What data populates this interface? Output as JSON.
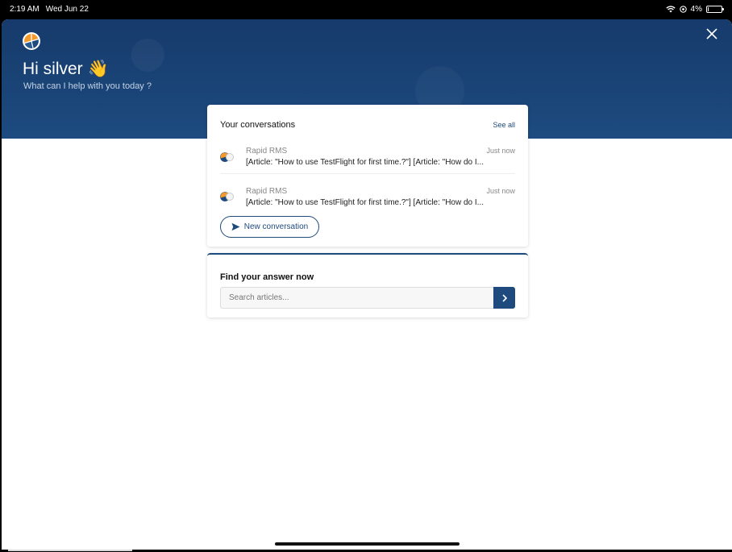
{
  "status_bar": {
    "time": "2:19 AM",
    "date": "Wed Jun 22",
    "battery": "4%"
  },
  "hero": {
    "greeting": "Hi silver 👋",
    "subtitle": "What can I help with you today ?"
  },
  "conversations": {
    "title": "Your conversations",
    "see_all": "See all",
    "items": [
      {
        "name": "Rapid RMS",
        "time": "Just now",
        "message": "[Article: \"How to use TestFlight for first time.?\"] [Article: \"How do I..."
      },
      {
        "name": "Rapid RMS",
        "time": "Just now",
        "message": "[Article: \"How to use TestFlight for first time.?\"] [Article: \"How do I..."
      }
    ],
    "new_conversation": "New conversation"
  },
  "find": {
    "title": "Find your answer now",
    "placeholder": "Search articles..."
  },
  "colors": {
    "brand": "#1e4a7d",
    "hero_bg": "#1a4275",
    "logo_orange": "#f29a2e",
    "logo_blue": "#1e4a7d"
  }
}
